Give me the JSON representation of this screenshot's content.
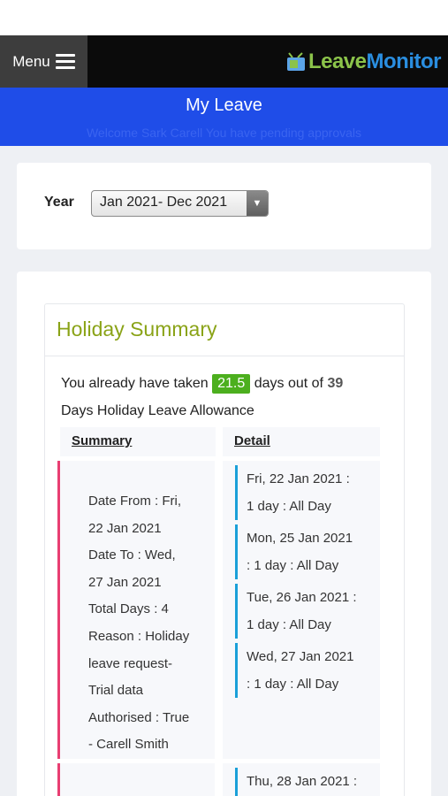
{
  "nav": {
    "menu_label": "Menu",
    "logo_part1": "Leave",
    "logo_part2": "Monitor"
  },
  "header": {
    "title": "My Leave",
    "welcome": "Welcome Sark Carell     You have     pending     approvals"
  },
  "year": {
    "label": "Year",
    "selected": "Jan 2021- Dec 2021"
  },
  "summary": {
    "heading": "Holiday Summary",
    "taken_prefix": "You already have taken",
    "taken_value": "21.5",
    "taken_middle": "days out of",
    "allowance_value": "39",
    "allowance_suffix": "Days Holiday Leave Allowance",
    "col_summary": "Summary",
    "col_detail": "Detail",
    "entries": [
      {
        "summary_lines": [
          "Date From : Fri,",
          "22 Jan 2021",
          "Date To : Wed,",
          "27 Jan 2021",
          "Total Days : 4",
          "Reason : Holiday",
          "leave request-",
          "Trial data",
          "Authorised : True",
          "- Carell Smith"
        ],
        "details": [
          [
            "Fri, 22 Jan 2021 :",
            "1 day : All Day"
          ],
          [
            "Mon, 25 Jan 2021",
            ": 1 day : All Day"
          ],
          [
            "Tue, 26 Jan 2021 :",
            "1 day : All Day"
          ],
          [
            "Wed, 27 Jan 2021",
            ": 1 day : All Day"
          ]
        ]
      },
      {
        "details": [
          [
            "Thu, 28 Jan 2021 :"
          ]
        ]
      }
    ]
  }
}
